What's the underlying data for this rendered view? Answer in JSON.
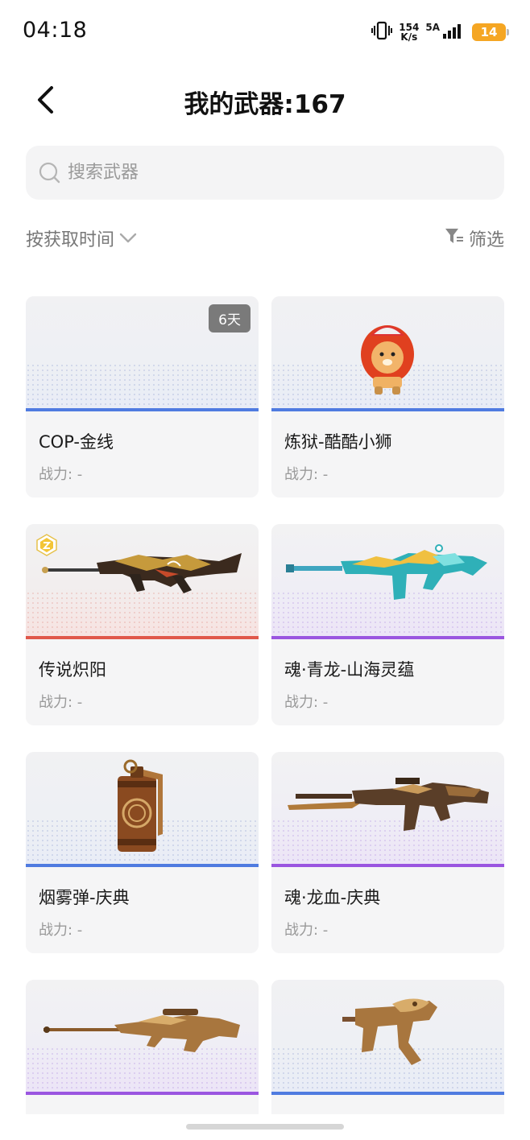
{
  "status_bar": {
    "time": "04:18",
    "net_speed_value": "154",
    "net_speed_unit": "K/s",
    "signal_label": "5A",
    "battery": "14"
  },
  "header": {
    "title": "我的武器:167",
    "back_icon": "chevron-left-icon"
  },
  "search": {
    "placeholder": "搜索武器",
    "value": ""
  },
  "sort": {
    "label": "按获取时间",
    "icon": "chevron-down-icon"
  },
  "filter": {
    "label": "筛选",
    "icon": "filter-icon"
  },
  "colors": {
    "rarity_blue": "#4f7be0",
    "rarity_red": "#e0584a",
    "rarity_purple": "#9a55e0",
    "badge_bg": "#7a7a7a",
    "battery": "#f5a623"
  },
  "weapons": [
    {
      "name": "COP-金线",
      "power": "战力: -",
      "badge": "6天",
      "rarity": "blue",
      "art": "empty"
    },
    {
      "name": "炼狱-酷酷小狮",
      "power": "战力: -",
      "rarity": "blue",
      "art": "lion-mascot"
    },
    {
      "name": "传说炽阳",
      "power": "战力: -",
      "rarity": "red",
      "legend": true,
      "art": "sniper-rifle-dark-gold"
    },
    {
      "name": "魂·青龙-山海灵蕴",
      "power": "战力: -",
      "rarity": "purple",
      "art": "rifle-cyan-dragon"
    },
    {
      "name": "烟雾弹-庆典",
      "power": "战力: -",
      "rarity": "blue",
      "art": "smoke-grenade"
    },
    {
      "name": "魂·龙血-庆典",
      "power": "战力: -",
      "rarity": "purple",
      "art": "rifle-bronze"
    },
    {
      "name": "",
      "power": "",
      "rarity": "purple",
      "art": "sniper-rifle-bronze"
    },
    {
      "name": "",
      "power": "",
      "rarity": "blue",
      "art": "smg-bronze"
    }
  ]
}
